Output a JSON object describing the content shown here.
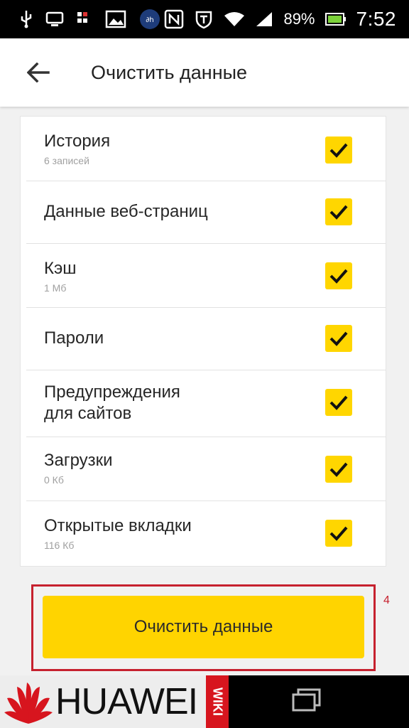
{
  "status_bar": {
    "battery_percent": "89%",
    "time": "7:52",
    "icons": [
      "usb-icon",
      "cast-icon",
      "sim-icon",
      "image-icon",
      "app-badge-icon",
      "nfc-icon",
      "shield-icon",
      "wifi-icon",
      "signal-icon",
      "battery-icon"
    ]
  },
  "header": {
    "title": "Очистить данные"
  },
  "items": [
    {
      "title": "История",
      "subtitle": "6 записей",
      "checked": true
    },
    {
      "title": "Данные веб-страниц",
      "subtitle": "",
      "checked": true
    },
    {
      "title": "Кэш",
      "subtitle": "1 Мб",
      "checked": true
    },
    {
      "title": "Пароли",
      "subtitle": "",
      "checked": true
    },
    {
      "title": "Предупреждения\nдля сайтов",
      "subtitle": "",
      "checked": true
    },
    {
      "title": "Загрузки",
      "subtitle": "0 Кб",
      "checked": true
    },
    {
      "title": "Открытые вкладки",
      "subtitle": "116 Кб",
      "checked": true
    }
  ],
  "clear_button": {
    "label": "Очистить данные"
  },
  "annotation": {
    "step": "4"
  },
  "watermark": {
    "brand": "HUAWEI",
    "wiki": "WIKI"
  },
  "colors": {
    "accent": "#ffd600",
    "highlight": "#c6212e",
    "brand_red": "#d7151e"
  }
}
